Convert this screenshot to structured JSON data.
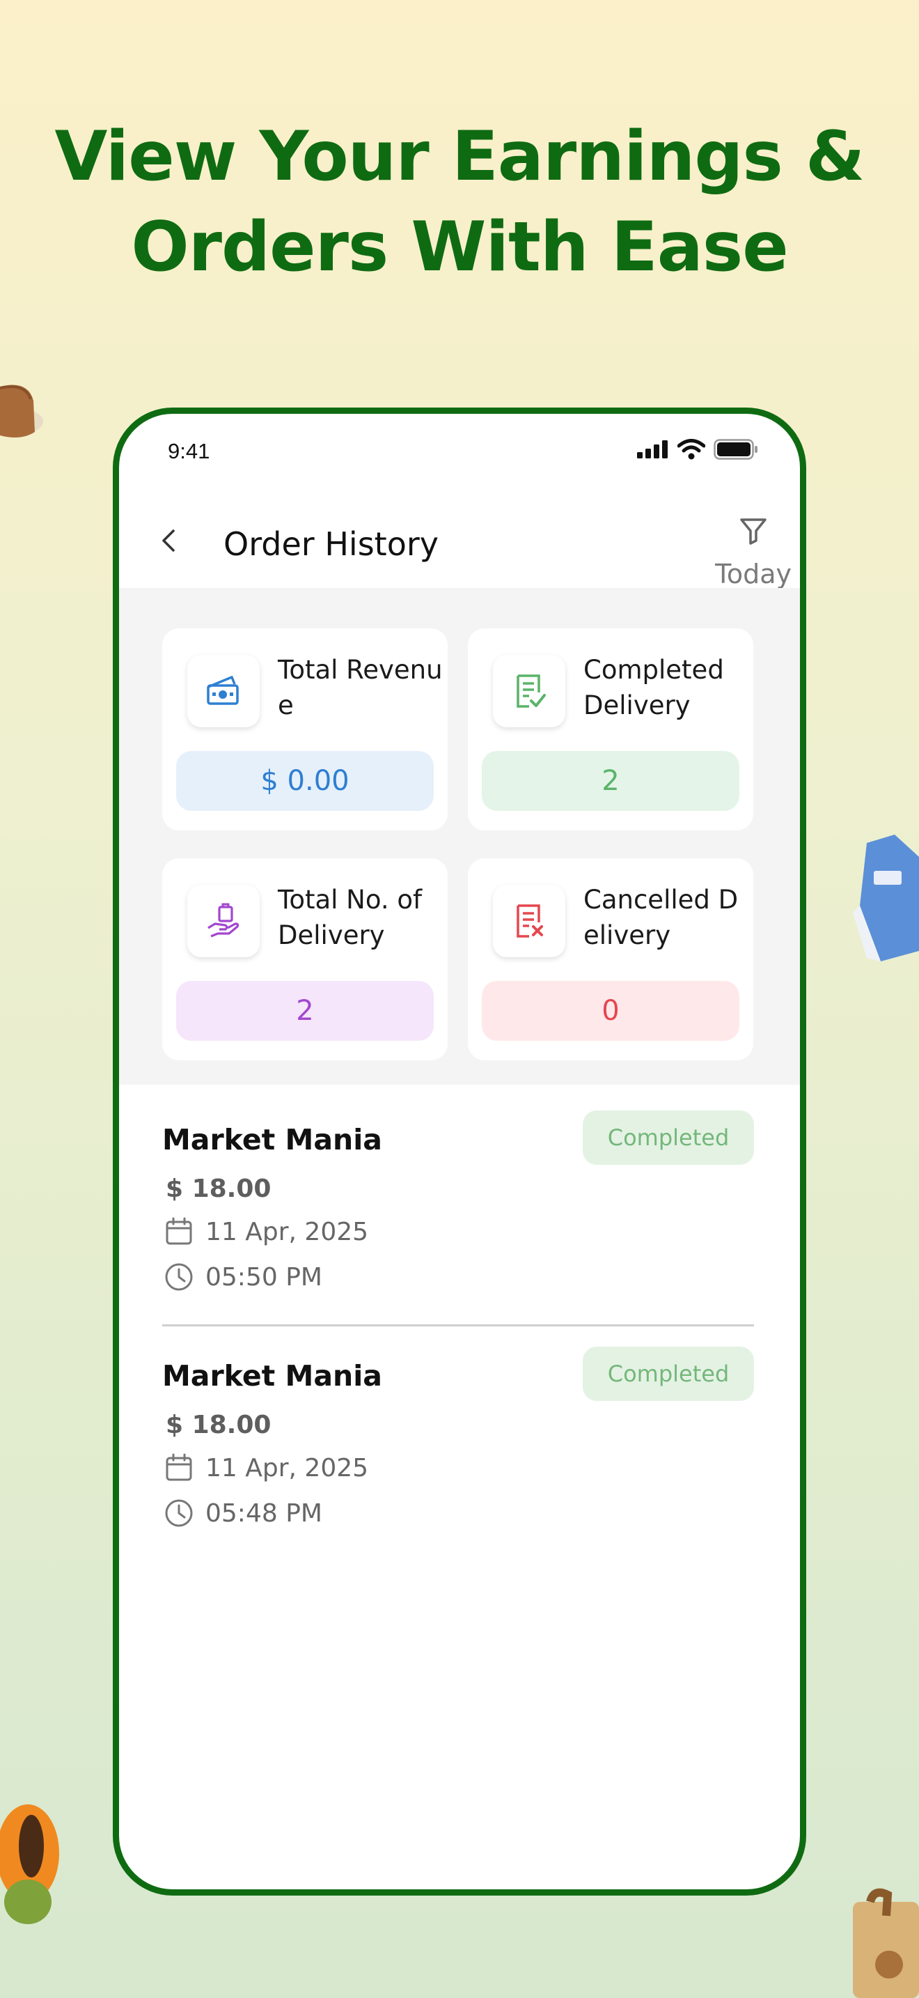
{
  "headline": {
    "line1": "View Your Earnings &",
    "line2": "Orders With Ease"
  },
  "status_bar": {
    "time": "9:41"
  },
  "app_bar": {
    "title": "Order History",
    "filter_label": "Today"
  },
  "stats": [
    {
      "label": "Total Revenue",
      "value": "$ 0.00",
      "icon": "money-icon",
      "color": "#2e7fd1"
    },
    {
      "label": "Completed Delivery",
      "value": "2",
      "icon": "checklist-icon",
      "color": "#59b46a"
    },
    {
      "label": "Total No. of Delivery",
      "value": "2",
      "icon": "hand-package-icon",
      "color": "#a247cf"
    },
    {
      "label": "Cancelled Delivery",
      "value": "0",
      "icon": "cancel-receipt-icon",
      "color": "#e5474f"
    }
  ],
  "orders": [
    {
      "store": "Market Mania",
      "status": "Completed",
      "price": "$ 18.00",
      "date": "11 Apr, 2025",
      "time": "05:50 PM"
    },
    {
      "store": "Market Mania",
      "status": "Completed",
      "price": "$ 18.00",
      "date": "11 Apr, 2025",
      "time": "05:48 PM"
    }
  ],
  "colors": {
    "brand_green": "#0f6b12",
    "badge_bg": "#e4f2e4",
    "badge_text": "#74b77a"
  }
}
